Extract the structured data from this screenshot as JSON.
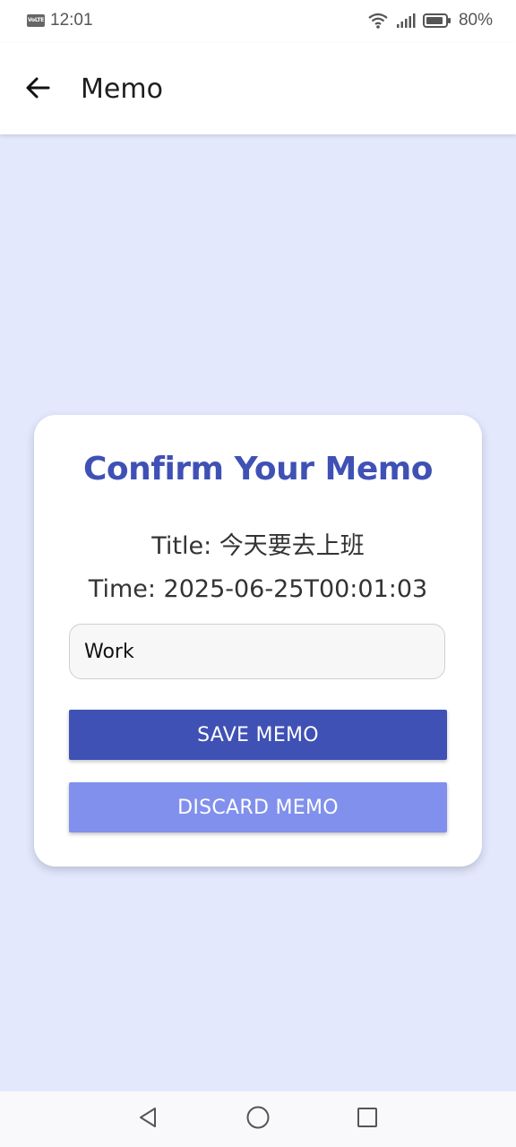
{
  "status_bar": {
    "network_badge": "VoLTE",
    "time": "12:01",
    "battery": "80%",
    "icons": [
      "wifi-icon",
      "signal-icon",
      "battery-icon"
    ]
  },
  "app_bar": {
    "title": "Memo",
    "back_icon": "arrow-left-icon"
  },
  "card": {
    "heading": "Confirm Your Memo",
    "title_line": "Title: 今天要去上班",
    "time_line": "Time: 2025-06-25T00:01:03",
    "category_input_value": "Work",
    "save_label": "SAVE MEMO",
    "discard_label": "DISCARD MEMO"
  },
  "nav_bar": {
    "icons": [
      "nav-back-icon",
      "nav-home-icon",
      "nav-recent-icon"
    ]
  },
  "colors": {
    "background": "#e3e8fd",
    "primary": "#3f51b5",
    "secondary": "#8190ec",
    "card": "#ffffff"
  }
}
